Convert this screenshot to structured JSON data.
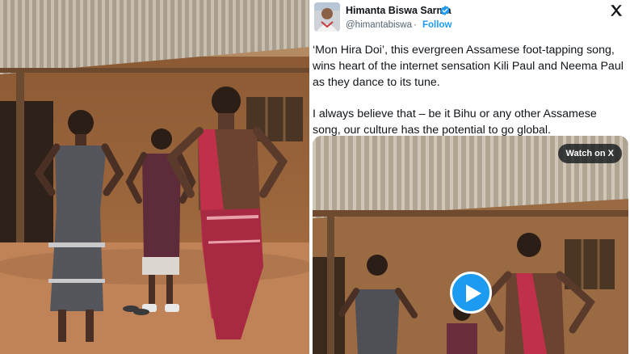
{
  "tweet": {
    "author_name": "Himanta Biswa Sarma",
    "author_handle": "@himantabiswa",
    "separator": "·",
    "follow_label": "Follow",
    "paragraphs": [
      "‘Mon Hira Doi’, this evergreen Assamese foot-tapping song, wins heart of the internet sensation Kili Paul and Neema Paul as they dance to its tune.",
      "I always believe that – be it Bihu or any other Assamese song, our culture has the potential to go global."
    ],
    "watch_label": "Watch on X",
    "brand_icon": "x-logo-icon",
    "verified_icon": "verified-badge-icon",
    "play_icon": "play-icon"
  },
  "colors": {
    "accent": "#1d9bf0",
    "text": "#0f1419",
    "muted": "#536471"
  }
}
